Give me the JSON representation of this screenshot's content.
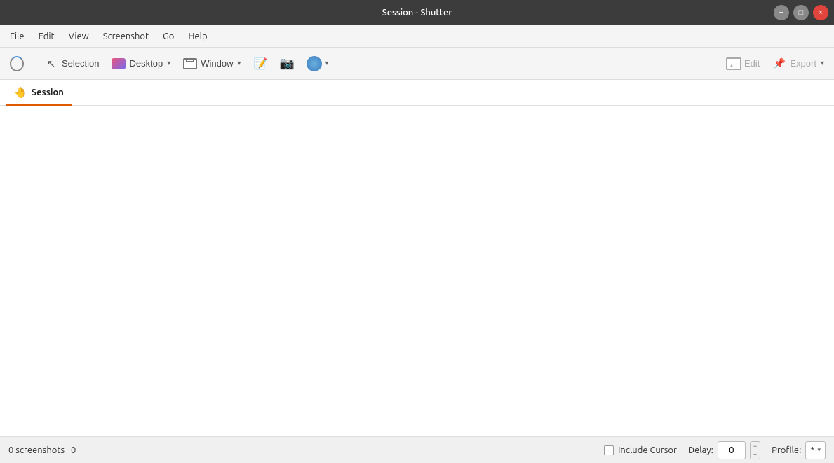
{
  "titlebar": {
    "title": "Session - Shutter"
  },
  "window_controls": {
    "minimize_label": "−",
    "maximize_label": "□",
    "close_label": "×"
  },
  "menubar": {
    "items": [
      {
        "id": "file",
        "label": "File"
      },
      {
        "id": "edit",
        "label": "Edit"
      },
      {
        "id": "view",
        "label": "View"
      },
      {
        "id": "screenshot",
        "label": "Screenshot"
      },
      {
        "id": "go",
        "label": "Go"
      },
      {
        "id": "help",
        "label": "Help"
      }
    ]
  },
  "toolbar": {
    "reload_tooltip": "Reload",
    "selection_label": "Selection",
    "desktop_label": "Desktop",
    "desktop_arrow": "▾",
    "window_label": "Window",
    "window_arrow": "▾",
    "capture_arrow": "▾",
    "edit_label": "Edit",
    "export_label": "Export",
    "export_arrow": "▾"
  },
  "tabs": [
    {
      "id": "session",
      "label": "Session",
      "icon": "🤚",
      "active": true
    }
  ],
  "main": {
    "content": ""
  },
  "statusbar": {
    "screenshots_count": "0 screenshots",
    "screenshots_extra": "0",
    "include_cursor_label": "Include Cursor",
    "delay_label": "Delay:",
    "delay_value": "0",
    "decrement_label": "−",
    "increment_label": "+",
    "profile_label": "Profile:",
    "profile_value": "*",
    "profile_arrow": "▾"
  }
}
